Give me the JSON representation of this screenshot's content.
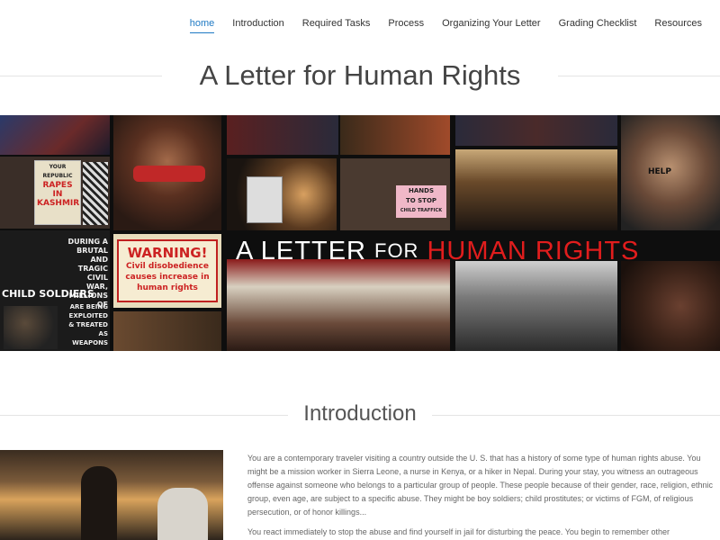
{
  "nav": {
    "items": [
      "home",
      "Introduction",
      "Required Tasks",
      "Process",
      "Organizing Your Letter",
      "Grading Checklist",
      "Resources"
    ],
    "active_index": 0
  },
  "page_title": "A Letter for Human Rights",
  "banner": {
    "overlay_a": "A LETTER",
    "overlay_for": "FOR",
    "overlay_b": "HUMAN RIGHTS",
    "signs": {
      "your": "YOUR",
      "republic": "REPUBLIC",
      "rapes": "RAPES IN",
      "kashmir": "KASHMIR",
      "hands": "HANDS",
      "to_stop": "TO STOP",
      "child_traffic": "CHILD TRAFFICK",
      "help": "HELP",
      "during": "DURING A",
      "brutal": "BRUTAL",
      "tragic": "AND TRAGIC",
      "civil_war": "CIVIL WAR,",
      "millions": "MILLIONS OF",
      "child_soldiers": "CHILD SOLDIERS",
      "are_being": "ARE BEING",
      "exploited": "EXPLOITED",
      "treated": "& TREATED AS",
      "weapons": "WEAPONS",
      "warning": "WARNING!",
      "civil_dis": "Civil disobedience",
      "causes": "causes increase in",
      "human_rights": "human rights"
    },
    "colors": {
      "overlay_text": "#ffffff",
      "overlay_accent": "#e11d1d"
    }
  },
  "introduction": {
    "heading": "Introduction",
    "paragraphs": [
      "You are a contemporary traveler visiting a country outside the U. S. that has a history of some type of human rights abuse. You might be a mission worker in Sierra Leone, a nurse in Kenya, or a hiker in Nepal. During your stay, you witness an outrageous offense against someone who belongs to a particular group of people. These people because of their gender, race, religion, ethnic group, even age, are subject to a specific abuse. They might be boy soldiers; child prostitutes; or victims of FGM, of religious persecution, or of honor killings...",
      "You react immediately to stop the abuse and find yourself in jail for disturbing the peace. You begin to remember other"
    ]
  },
  "colors": {
    "accent": "#1f7ac4",
    "title": "#444444",
    "body_text": "#666666"
  }
}
